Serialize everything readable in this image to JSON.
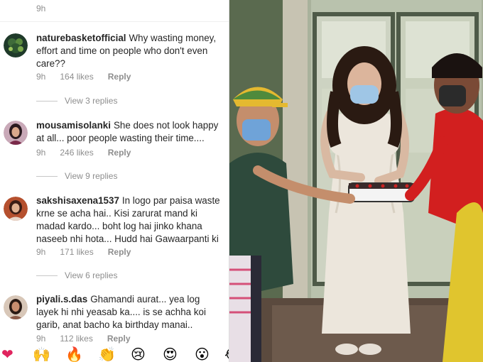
{
  "top_comment_time": "9h",
  "comments": [
    {
      "username": "naturebasketofficial",
      "text": "Why wasting money, effort and time on people who don't even care??",
      "time": "9h",
      "likes": "164 likes",
      "reply_label": "Reply",
      "view_replies": "View 3 replies"
    },
    {
      "username": "mousamisolanki",
      "text": "She does not look happy at all... poor people wasting their time....",
      "time": "9h",
      "likes": "246 likes",
      "reply_label": "Reply",
      "view_replies": "View 9 replies"
    },
    {
      "username": "sakshisaxena1537",
      "text": "In logo par paisa waste krne se acha hai.. Kisi zarurat mand ki madad kardo... boht log hai jinko khana naseeb nhi hota... Hudd hai Gawaarpanti ki",
      "time": "9h",
      "likes": "171 likes",
      "reply_label": "Reply",
      "view_replies": "View 6 replies"
    },
    {
      "username": "piyali.s.das",
      "text": "Ghamandi aurat... yea log layek hi nhi yeasab ka.... is se achha koi garib, anat bacho ka birthday manai..",
      "time": "9h",
      "likes": "112 likes",
      "reply_label": "Reply"
    }
  ],
  "emoji_bar": [
    "❤",
    "🙌",
    "🔥",
    "👏",
    "😢",
    "😍",
    "😮",
    "😂"
  ],
  "photo": {
    "description_icon": "photo-of-woman-cutting-cake"
  },
  "colors": {
    "text": "#262626",
    "muted": "#8e8e8e",
    "cake": "#f4f4f4",
    "dress": "#ece6dc",
    "red_shirt": "#d21f1f"
  }
}
